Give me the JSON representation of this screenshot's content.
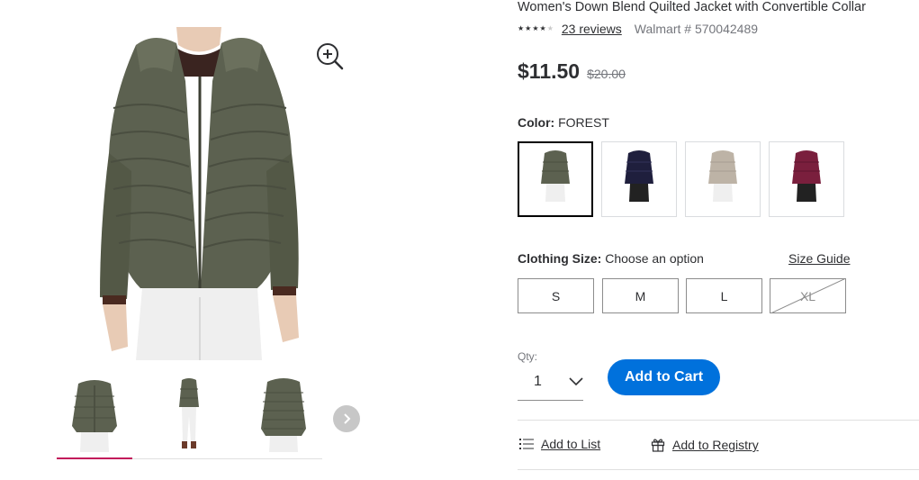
{
  "product": {
    "title": "Women's Down Blend Quilted Jacket with Convertible Collar",
    "rating": 4,
    "rating_max": 5,
    "reviews_link": "23 reviews",
    "walmart_number": "Walmart # 570042489",
    "price": "$11.50",
    "was_price": "$20.00"
  },
  "gallery": {
    "zoom_icon": "zoom-in-icon",
    "thumbnails": [
      {
        "color": "#5c6150",
        "view": "front"
      },
      {
        "color": "#5c6150",
        "view": "full-body"
      },
      {
        "color": "#5c6150",
        "view": "back"
      }
    ],
    "active_thumbnail": 0,
    "next_icon": "chevron-right-icon",
    "accent_color": "#c2185b"
  },
  "color": {
    "label": "Color:",
    "value": "FOREST",
    "swatches": [
      {
        "name": "forest",
        "hex": "#5c6150",
        "selected": true
      },
      {
        "name": "navy",
        "hex": "#1f1f3d",
        "selected": false
      },
      {
        "name": "beige",
        "hex": "#bdb3a6",
        "selected": false
      },
      {
        "name": "burgundy",
        "hex": "#7a1f3d",
        "selected": false
      }
    ]
  },
  "size": {
    "label": "Clothing Size:",
    "value": "Choose an option",
    "guide": "Size Guide",
    "options": [
      {
        "label": "S",
        "available": true
      },
      {
        "label": "M",
        "available": true
      },
      {
        "label": "L",
        "available": true
      },
      {
        "label": "XL",
        "available": false
      }
    ]
  },
  "quantity": {
    "label": "Qty:",
    "value": "1"
  },
  "cart": {
    "add_label": "Add to Cart",
    "button_color": "#0071dc"
  },
  "links": {
    "list": "Add to List",
    "registry": "Add to Registry",
    "list_icon": "list-icon",
    "registry_icon": "gift-icon"
  }
}
